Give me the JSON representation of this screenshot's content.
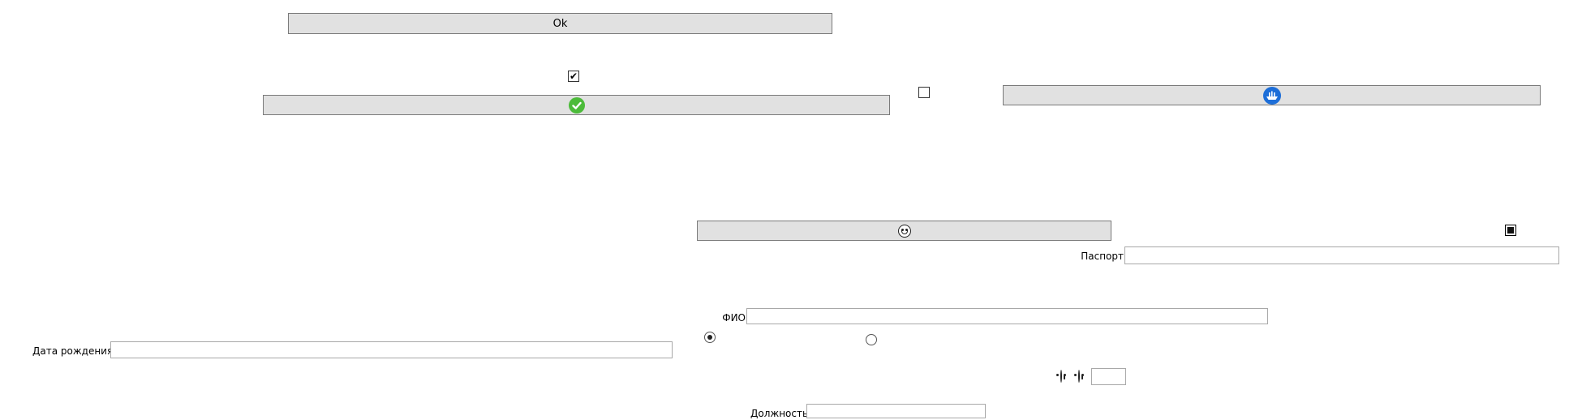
{
  "buttons": {
    "ok_label": "Ok"
  },
  "icons": {
    "check_badge": "check-circle-green-icon",
    "boat_badge": "boat-circle-blue-icon",
    "laugh_emoji": "laughing-face-icon",
    "smile_emoji": "grinning-face-icon"
  },
  "colors": {
    "check_badge": "#4cbb3a",
    "boat_badge": "#1d6ed8",
    "button_bg": "#e1e1e1"
  },
  "checkboxes": {
    "top_checked": true,
    "middle_checked": false,
    "right_indeterminate": true
  },
  "radios": {
    "first_selected": true,
    "second_selected": false
  },
  "fields": {
    "passport_label": "Паспорт",
    "passport_value": "",
    "fio_label": "ФИО",
    "fio_value": "",
    "birthdate_label": "Дата рождения",
    "birthdate_value": "",
    "position_label": "Должность",
    "position_value": "",
    "emoji_field_value": ""
  }
}
